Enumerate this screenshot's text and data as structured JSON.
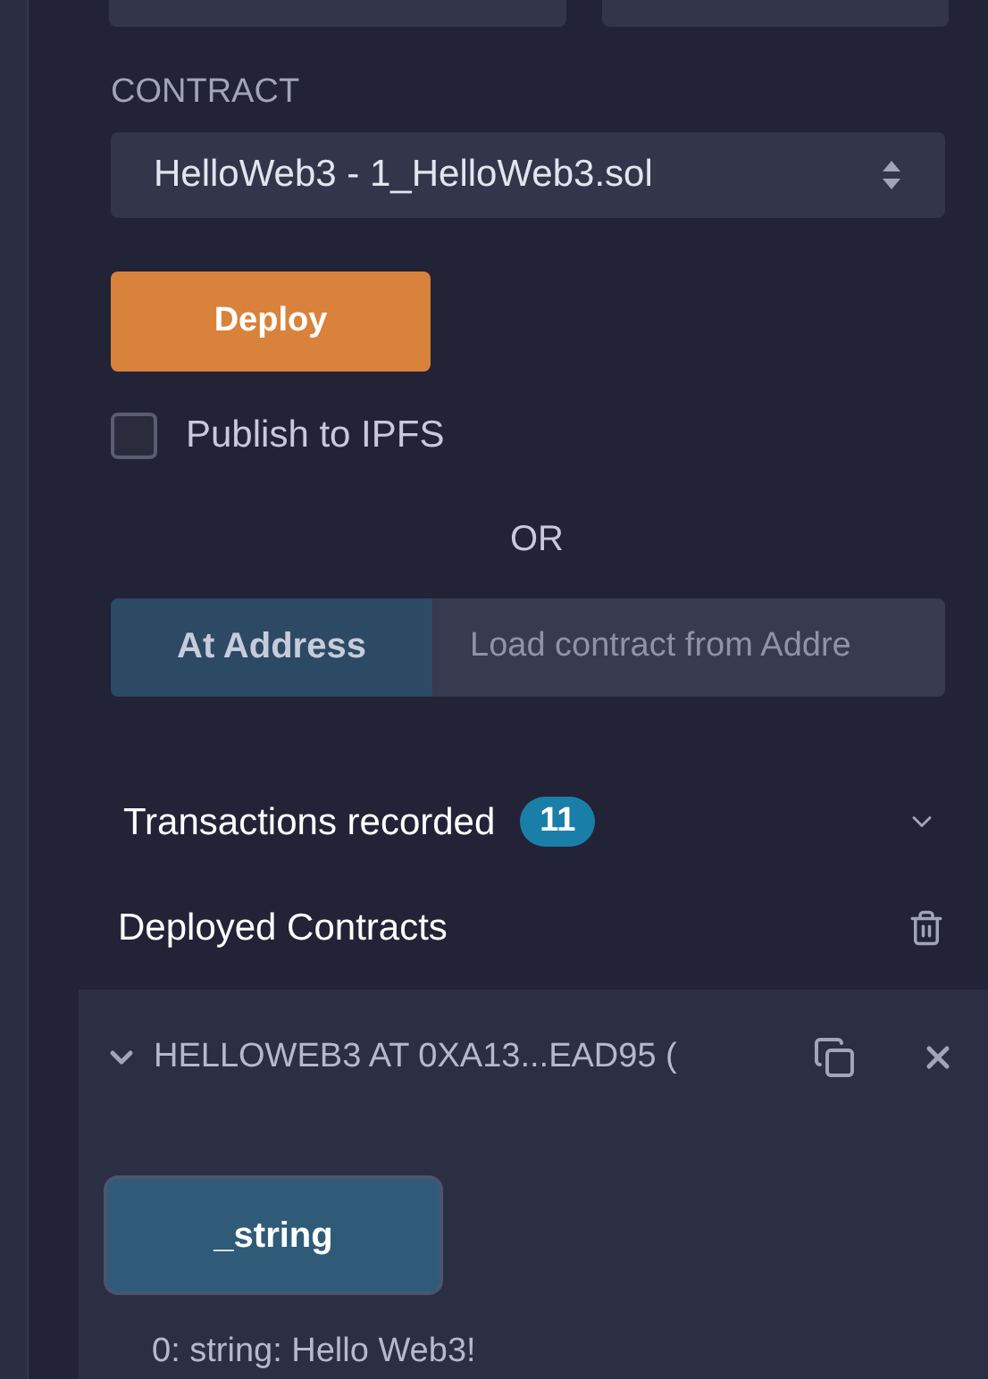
{
  "contract": {
    "label": "CONTRACT",
    "value": "HelloWeb3 - 1_HelloWeb3.sol"
  },
  "deploy": {
    "label": "Deploy"
  },
  "publish": {
    "label": "Publish to IPFS",
    "checked": false
  },
  "or_label": "OR",
  "at_address": {
    "button": "At Address",
    "placeholder": "Load contract from Addre"
  },
  "transactions": {
    "label": "Transactions recorded",
    "count": "11",
    "expanded": false
  },
  "deployed": {
    "title": "Deployed Contracts"
  },
  "instance": {
    "title": "HELLOWEB3 AT 0XA13...EAD95 (",
    "expanded": true,
    "functions": [
      {
        "label": "_string",
        "output": "0: string: Hello Web3!"
      }
    ]
  }
}
